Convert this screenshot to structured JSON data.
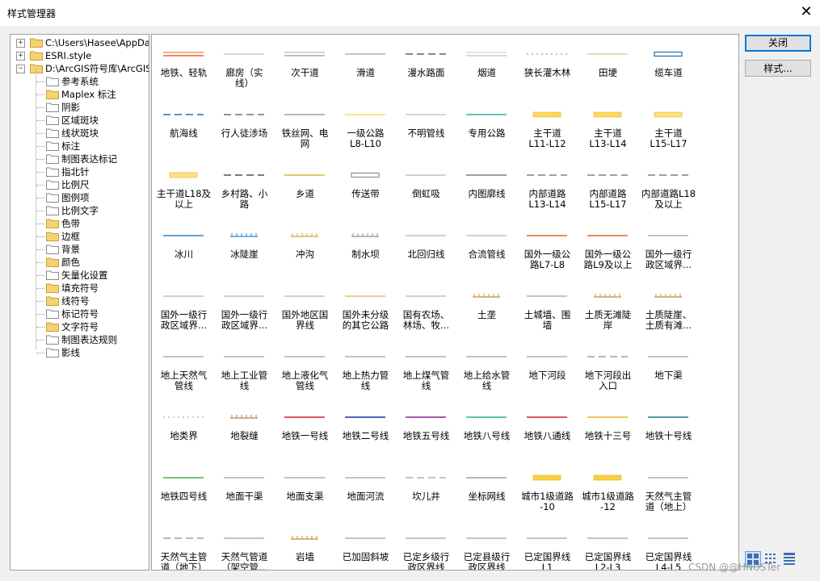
{
  "window": {
    "title": "样式管理器",
    "close_glyph": "✕"
  },
  "tree": {
    "root_items": [
      {
        "label": "C:\\Users\\Hasee\\AppData",
        "expander": "+"
      },
      {
        "label": "ESRI.style",
        "expander": "+"
      },
      {
        "label": "D:\\ArcGIS符号库\\ArcGIS",
        "expander": "−"
      }
    ],
    "children": [
      "参考系统",
      "Maplex 标注",
      "阴影",
      "区域斑块",
      "线状斑块",
      "标注",
      "制图表达标记",
      "指北针",
      "比例尺",
      "图例项",
      "比例文字",
      "色带",
      "边框",
      "背景",
      "颜色",
      "矢量化设置",
      "填充符号",
      "线符号",
      "标记符号",
      "文字符号",
      "制图表达规则",
      "影线"
    ],
    "filled_children": [
      1,
      11,
      12,
      14,
      16,
      17,
      19
    ],
    "selected": "线符号"
  },
  "buttons": {
    "close": "关闭",
    "style": "样式..."
  },
  "symbols": [
    {
      "label": "地铁、轻轨",
      "style": "double",
      "color": "#e8641e"
    },
    {
      "label": "廊房（实\n线）",
      "style": "line",
      "color": "#c8c8c8"
    },
    {
      "label": "次干道",
      "style": "double",
      "color": "#a8a8a8"
    },
    {
      "label": "滑道",
      "style": "line",
      "color": "#b0b0b0"
    },
    {
      "label": "漫水路面",
      "style": "dash",
      "color": "#606060"
    },
    {
      "label": "烟道",
      "style": "double",
      "color": "#c8c8c8"
    },
    {
      "label": "狭长灌木林",
      "style": "dots",
      "color": "#7ec87e"
    },
    {
      "label": "田埂",
      "style": "line",
      "color": "#d0d0a0"
    },
    {
      "label": "缆车道",
      "style": "box",
      "color": "#1e6ea8"
    },
    {
      "label": "航海线",
      "style": "dash",
      "color": "#2b6cb0"
    },
    {
      "label": "行人徒涉场",
      "style": "dash",
      "color": "#707070"
    },
    {
      "label": "铁丝网、电\n网",
      "style": "line",
      "color": "#a0a0a0"
    },
    {
      "label": "一级公路\nL8-L10",
      "style": "line",
      "color": "#ffd85a"
    },
    {
      "label": "不明管线",
      "style": "line",
      "color": "#c8c8c8"
    },
    {
      "label": "专用公路",
      "style": "line",
      "color": "#2ab0a0"
    },
    {
      "label": "主干道\nL11-L12",
      "style": "band",
      "color": "#ffd85a"
    },
    {
      "label": "主干道\nL13-L14",
      "style": "band",
      "color": "#ffd85a"
    },
    {
      "label": "主干道\nL15-L17",
      "style": "band",
      "color": "#ffe27a"
    },
    {
      "label": "主干道L18及\n以上",
      "style": "band",
      "color": "#ffe27a"
    },
    {
      "label": "乡村路、小\n路",
      "style": "dash",
      "color": "#505050"
    },
    {
      "label": "乡道",
      "style": "line",
      "color": "#e0b040"
    },
    {
      "label": "传送带",
      "style": "box",
      "color": "#909090"
    },
    {
      "label": "倒虹吸",
      "style": "line",
      "color": "#c0c0c0"
    },
    {
      "label": "内图廓线",
      "style": "line",
      "color": "#808080"
    },
    {
      "label": "内部道路\nL13-L14",
      "style": "dash",
      "color": "#808080"
    },
    {
      "label": "内部道路\nL15-L17",
      "style": "dash",
      "color": "#808080"
    },
    {
      "label": "内部道路L18\n及以上",
      "style": "dash",
      "color": "#808080"
    },
    {
      "label": "冰川",
      "style": "line",
      "color": "#2b8ad0"
    },
    {
      "label": "冰陡崖",
      "style": "ticks",
      "color": "#2b8ad0"
    },
    {
      "label": "冲沟",
      "style": "ticks",
      "color": "#e0a040"
    },
    {
      "label": "制水坝",
      "style": "ticks",
      "color": "#909090"
    },
    {
      "label": "北回归线",
      "style": "line",
      "color": "#c0c0c0"
    },
    {
      "label": "合流管线",
      "style": "line",
      "color": "#c0c0c0"
    },
    {
      "label": "国外一级公\n路L7-L8",
      "style": "line",
      "color": "#e86020"
    },
    {
      "label": "国外一级公\n路L9及以上",
      "style": "line",
      "color": "#e86020"
    },
    {
      "label": "国外一级行\n政区域界...",
      "style": "line",
      "color": "#b0b0b0"
    },
    {
      "label": "国外一级行\n政区域界...",
      "style": "line",
      "color": "#c0c0c0"
    },
    {
      "label": "国外一级行\n政区域界...",
      "style": "line",
      "color": "#c0c0c0"
    },
    {
      "label": "国外地区国\n界线",
      "style": "line",
      "color": "#c0c0c0"
    },
    {
      "label": "国外未分级\n的其它公路",
      "style": "line",
      "color": "#e0c070"
    },
    {
      "label": "国有农场、\n林场、牧...",
      "style": "line",
      "color": "#c0c0c0"
    },
    {
      "label": "土垄",
      "style": "ticks",
      "color": "#c09040"
    },
    {
      "label": "土城墙、围\n墙",
      "style": "line",
      "color": "#b0b0b0"
    },
    {
      "label": "土质无滩陡\n岸",
      "style": "ticks",
      "color": "#c09040"
    },
    {
      "label": "土质陡崖、\n土质有滩...",
      "style": "ticks",
      "color": "#c09040"
    },
    {
      "label": "地上天然气\n管线",
      "style": "line",
      "color": "#b0b0b0"
    },
    {
      "label": "地上工业管\n线",
      "style": "line",
      "color": "#b0b0b0"
    },
    {
      "label": "地上液化气\n管线",
      "style": "line",
      "color": "#b0b0b0"
    },
    {
      "label": "地上热力管\n线",
      "style": "line",
      "color": "#b0b0b0"
    },
    {
      "label": "地上煤气管\n线",
      "style": "line",
      "color": "#b0b0b0"
    },
    {
      "label": "地上给水管\n线",
      "style": "line",
      "color": "#b0b0b0"
    },
    {
      "label": "地下河段",
      "style": "line",
      "color": "#b0b0b0"
    },
    {
      "label": "地下河段出\n入口",
      "style": "dash",
      "color": "#a0a0a0"
    },
    {
      "label": "地下渠",
      "style": "line",
      "color": "#b0b0b0"
    },
    {
      "label": "地类界",
      "style": "dots",
      "color": "#c0c0c0"
    },
    {
      "label": "地裂缝",
      "style": "ticks",
      "color": "#b08050"
    },
    {
      "label": "地铁一号线",
      "style": "line",
      "color": "#d62020"
    },
    {
      "label": "地铁二号线",
      "style": "line",
      "color": "#1a2ea0"
    },
    {
      "label": "地铁五号线",
      "style": "line",
      "color": "#8a2090"
    },
    {
      "label": "地铁八号线",
      "style": "line",
      "color": "#2ab090"
    },
    {
      "label": "地铁八通线",
      "style": "line",
      "color": "#d62020"
    },
    {
      "label": "地铁十三号",
      "style": "line",
      "color": "#f0b020"
    },
    {
      "label": "地铁十号线",
      "style": "line",
      "color": "#207890"
    },
    {
      "label": "地铁四号线",
      "style": "line",
      "color": "#40b040"
    },
    {
      "label": "地面干渠",
      "style": "line",
      "color": "#b0b0b0"
    },
    {
      "label": "地面支渠",
      "style": "line",
      "color": "#b0b0b0"
    },
    {
      "label": "地面河流",
      "style": "line",
      "color": "#b0b0b0"
    },
    {
      "label": "坎儿井",
      "style": "dash",
      "color": "#b0b0b0"
    },
    {
      "label": "坐标网线",
      "style": "line",
      "color": "#a0a0a0"
    },
    {
      "label": "城市1级道路\n-10",
      "style": "band",
      "color": "#f8d040"
    },
    {
      "label": "城市1级道路\n-12",
      "style": "band",
      "color": "#f8d040"
    },
    {
      "label": "天然气主管\n道（地上）",
      "style": "line",
      "color": "#b0b0b0"
    },
    {
      "label": "天然气主管\n道（地下）",
      "style": "dash",
      "color": "#a0a0a0"
    },
    {
      "label": "天然气管道\n（架空管...",
      "style": "line",
      "color": "#b0b0b0"
    },
    {
      "label": "岩墙",
      "style": "ticks",
      "color": "#c09040"
    },
    {
      "label": "已加固斜坡",
      "style": "line",
      "color": "#b0b0b0"
    },
    {
      "label": "已定乡级行\n政区界线",
      "style": "line",
      "color": "#b0b0b0"
    },
    {
      "label": "已定县级行\n政区界线",
      "style": "line",
      "color": "#b0b0b0"
    },
    {
      "label": "已定国界线\nL1",
      "style": "line",
      "color": "#b0b0b0"
    },
    {
      "label": "已定国界线\nL2-L3",
      "style": "line",
      "color": "#b0b0b0"
    },
    {
      "label": "已定国界线\nL4-L5",
      "style": "line",
      "color": "#b0b0b0"
    }
  ],
  "watermark": "CSDN @@HNUSTer"
}
